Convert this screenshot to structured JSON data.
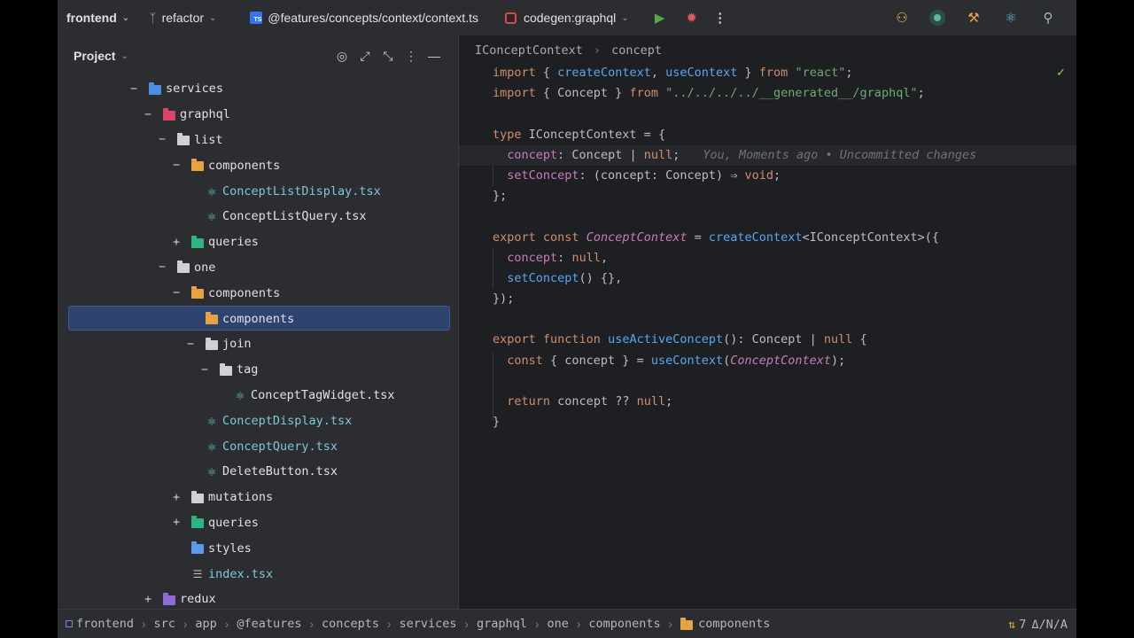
{
  "titlebar": {
    "project": "frontend",
    "branch": "refactor",
    "file_path": "@features/concepts/context/context.ts",
    "file_badge": "TS",
    "run_config": "codegen:graphql"
  },
  "project_panel": {
    "title": "Project",
    "tree": [
      {
        "label": "services",
        "depth": 0,
        "toggle": "−",
        "icon": "folder-blue-icon",
        "style": "plain"
      },
      {
        "label": "graphql",
        "depth": 1,
        "toggle": "−",
        "icon": "folder-pink-icon",
        "style": "plain"
      },
      {
        "label": "list",
        "depth": 2,
        "toggle": "−",
        "icon": "folder-icon",
        "style": "plain"
      },
      {
        "label": "components",
        "depth": 3,
        "toggle": "−",
        "icon": "folder-orange-icon",
        "style": "plain"
      },
      {
        "label": "ConceptListDisplay.tsx",
        "depth": 4,
        "toggle": "",
        "icon": "react-icon",
        "style": "react"
      },
      {
        "label": "ConceptListQuery.tsx",
        "depth": 4,
        "toggle": "",
        "icon": "react-icon",
        "style": "plain"
      },
      {
        "label": "queries",
        "depth": 3,
        "toggle": "+",
        "icon": "folder-teal-icon",
        "style": "plain"
      },
      {
        "label": "one",
        "depth": 2,
        "toggle": "−",
        "icon": "folder-icon",
        "style": "plain"
      },
      {
        "label": "components",
        "depth": 3,
        "toggle": "−",
        "icon": "folder-orange-icon",
        "style": "plain"
      },
      {
        "label": "components",
        "depth": 4,
        "toggle": "",
        "icon": "folder-orange-icon",
        "style": "plain",
        "selected": true
      },
      {
        "label": "join",
        "depth": 4,
        "toggle": "−",
        "icon": "folder-icon",
        "style": "plain"
      },
      {
        "label": "tag",
        "depth": 5,
        "toggle": "−",
        "icon": "folder-icon",
        "style": "plain"
      },
      {
        "label": "ConceptTagWidget.tsx",
        "depth": 6,
        "toggle": "",
        "icon": "react-icon",
        "style": "plain"
      },
      {
        "label": "ConceptDisplay.tsx",
        "depth": 4,
        "toggle": "",
        "icon": "react-icon",
        "style": "react"
      },
      {
        "label": "ConceptQuery.tsx",
        "depth": 4,
        "toggle": "",
        "icon": "react-icon",
        "style": "react"
      },
      {
        "label": "DeleteButton.tsx",
        "depth": 4,
        "toggle": "",
        "icon": "react-icon",
        "style": "plain"
      },
      {
        "label": "mutations",
        "depth": 3,
        "toggle": "+",
        "icon": "folder-icon",
        "style": "plain"
      },
      {
        "label": "queries",
        "depth": 3,
        "toggle": "+",
        "icon": "folder-teal-icon",
        "style": "plain"
      },
      {
        "label": "styles",
        "depth": 3,
        "toggle": "",
        "icon": "folder-lightblue-icon",
        "style": "plain"
      },
      {
        "label": "index.tsx",
        "depth": 3,
        "toggle": "",
        "icon": "index-file-icon",
        "style": "react"
      },
      {
        "label": "redux",
        "depth": 1,
        "toggle": "+",
        "icon": "folder-purple-icon",
        "style": "plain"
      }
    ]
  },
  "editor": {
    "breadcrumb": [
      "IConceptContext",
      "concept"
    ],
    "blame": "You, Moments ago • Uncommitted changes",
    "lines": [
      [
        [
          "kw",
          "import"
        ],
        [
          "pl",
          " { "
        ],
        [
          "fn",
          "createContext"
        ],
        [
          "pl",
          ", "
        ],
        [
          "fn",
          "useContext"
        ],
        [
          "pl",
          " } "
        ],
        [
          "kw",
          "from"
        ],
        [
          "pl",
          " "
        ],
        [
          "str",
          "\"react\""
        ],
        [
          "pl",
          ";"
        ]
      ],
      [
        [
          "kw",
          "import"
        ],
        [
          "pl",
          " { Concept } "
        ],
        [
          "kw",
          "from"
        ],
        [
          "pl",
          " "
        ],
        [
          "str",
          "\"../../../../__generated__/graphql\""
        ],
        [
          "pl",
          ";"
        ]
      ],
      [],
      [
        [
          "kw",
          "type"
        ],
        [
          "pl",
          " IConceptContext = {"
        ]
      ],
      [
        [
          "pl",
          "  "
        ],
        [
          "prop",
          "concept"
        ],
        [
          "pl",
          ": Concept | "
        ],
        [
          "kw",
          "null"
        ],
        [
          "pl",
          ";"
        ]
      ],
      [
        [
          "pl",
          "  "
        ],
        [
          "prop",
          "setConcept"
        ],
        [
          "pl",
          ": (concept: Concept) ⇒ "
        ],
        [
          "kw",
          "void"
        ],
        [
          "pl",
          ";"
        ]
      ],
      [
        [
          "pl",
          "};"
        ]
      ],
      [],
      [
        [
          "kw",
          "export const"
        ],
        [
          "pl",
          " "
        ],
        [
          "ital",
          "ConceptContext"
        ],
        [
          "pl",
          " = "
        ],
        [
          "fn",
          "createContext"
        ],
        [
          "pl",
          "<IConceptContext>({"
        ]
      ],
      [
        [
          "pl",
          "  "
        ],
        [
          "prop",
          "concept"
        ],
        [
          "pl",
          ": "
        ],
        [
          "kw",
          "null"
        ],
        [
          "pl",
          ","
        ]
      ],
      [
        [
          "pl",
          "  "
        ],
        [
          "fn",
          "setConcept"
        ],
        [
          "pl",
          "() {},"
        ]
      ],
      [
        [
          "pl",
          "});"
        ]
      ],
      [],
      [
        [
          "kw",
          "export function"
        ],
        [
          "pl",
          " "
        ],
        [
          "fn",
          "useActiveConcept"
        ],
        [
          "pl",
          "(): Concept | "
        ],
        [
          "kw",
          "null"
        ],
        [
          "pl",
          " {"
        ]
      ],
      [
        [
          "pl",
          "  "
        ],
        [
          "kw",
          "const"
        ],
        [
          "pl",
          " { concept } = "
        ],
        [
          "fn",
          "useContext"
        ],
        [
          "pl",
          "("
        ],
        [
          "ital",
          "ConceptContext"
        ],
        [
          "pl",
          ");"
        ]
      ],
      [],
      [
        [
          "pl",
          "  "
        ],
        [
          "kw",
          "return"
        ],
        [
          "pl",
          " concept ?? "
        ],
        [
          "kw",
          "null"
        ],
        [
          "pl",
          ";"
        ]
      ],
      [
        [
          "pl",
          "}"
        ]
      ]
    ]
  },
  "statusbar": {
    "path": [
      "frontend",
      "src",
      "app",
      "@features",
      "concepts",
      "services",
      "graphql",
      "one",
      "components",
      "components"
    ],
    "right_count": "7",
    "right_text": "Δ/N/A"
  },
  "colors": {
    "background": "#1e1f22",
    "panel": "#2b2d30",
    "selection": "#2e436e",
    "keyword": "#cf8e6d",
    "function": "#56a8f5",
    "string": "#6aab73",
    "property": "#c77dbb"
  }
}
